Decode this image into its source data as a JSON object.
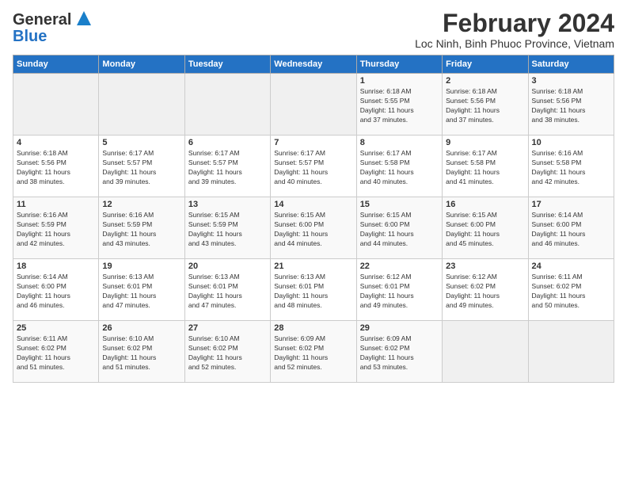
{
  "logo": {
    "line1": "General",
    "line2": "Blue"
  },
  "title": "February 2024",
  "location": "Loc Ninh, Binh Phuoc Province, Vietnam",
  "days_of_week": [
    "Sunday",
    "Monday",
    "Tuesday",
    "Wednesday",
    "Thursday",
    "Friday",
    "Saturday"
  ],
  "weeks": [
    [
      {
        "day": "",
        "info": ""
      },
      {
        "day": "",
        "info": ""
      },
      {
        "day": "",
        "info": ""
      },
      {
        "day": "",
        "info": ""
      },
      {
        "day": "1",
        "info": "Sunrise: 6:18 AM\nSunset: 5:55 PM\nDaylight: 11 hours\nand 37 minutes."
      },
      {
        "day": "2",
        "info": "Sunrise: 6:18 AM\nSunset: 5:56 PM\nDaylight: 11 hours\nand 37 minutes."
      },
      {
        "day": "3",
        "info": "Sunrise: 6:18 AM\nSunset: 5:56 PM\nDaylight: 11 hours\nand 38 minutes."
      }
    ],
    [
      {
        "day": "4",
        "info": "Sunrise: 6:18 AM\nSunset: 5:56 PM\nDaylight: 11 hours\nand 38 minutes."
      },
      {
        "day": "5",
        "info": "Sunrise: 6:17 AM\nSunset: 5:57 PM\nDaylight: 11 hours\nand 39 minutes."
      },
      {
        "day": "6",
        "info": "Sunrise: 6:17 AM\nSunset: 5:57 PM\nDaylight: 11 hours\nand 39 minutes."
      },
      {
        "day": "7",
        "info": "Sunrise: 6:17 AM\nSunset: 5:57 PM\nDaylight: 11 hours\nand 40 minutes."
      },
      {
        "day": "8",
        "info": "Sunrise: 6:17 AM\nSunset: 5:58 PM\nDaylight: 11 hours\nand 40 minutes."
      },
      {
        "day": "9",
        "info": "Sunrise: 6:17 AM\nSunset: 5:58 PM\nDaylight: 11 hours\nand 41 minutes."
      },
      {
        "day": "10",
        "info": "Sunrise: 6:16 AM\nSunset: 5:58 PM\nDaylight: 11 hours\nand 42 minutes."
      }
    ],
    [
      {
        "day": "11",
        "info": "Sunrise: 6:16 AM\nSunset: 5:59 PM\nDaylight: 11 hours\nand 42 minutes."
      },
      {
        "day": "12",
        "info": "Sunrise: 6:16 AM\nSunset: 5:59 PM\nDaylight: 11 hours\nand 43 minutes."
      },
      {
        "day": "13",
        "info": "Sunrise: 6:15 AM\nSunset: 5:59 PM\nDaylight: 11 hours\nand 43 minutes."
      },
      {
        "day": "14",
        "info": "Sunrise: 6:15 AM\nSunset: 6:00 PM\nDaylight: 11 hours\nand 44 minutes."
      },
      {
        "day": "15",
        "info": "Sunrise: 6:15 AM\nSunset: 6:00 PM\nDaylight: 11 hours\nand 44 minutes."
      },
      {
        "day": "16",
        "info": "Sunrise: 6:15 AM\nSunset: 6:00 PM\nDaylight: 11 hours\nand 45 minutes."
      },
      {
        "day": "17",
        "info": "Sunrise: 6:14 AM\nSunset: 6:00 PM\nDaylight: 11 hours\nand 46 minutes."
      }
    ],
    [
      {
        "day": "18",
        "info": "Sunrise: 6:14 AM\nSunset: 6:00 PM\nDaylight: 11 hours\nand 46 minutes."
      },
      {
        "day": "19",
        "info": "Sunrise: 6:13 AM\nSunset: 6:01 PM\nDaylight: 11 hours\nand 47 minutes."
      },
      {
        "day": "20",
        "info": "Sunrise: 6:13 AM\nSunset: 6:01 PM\nDaylight: 11 hours\nand 47 minutes."
      },
      {
        "day": "21",
        "info": "Sunrise: 6:13 AM\nSunset: 6:01 PM\nDaylight: 11 hours\nand 48 minutes."
      },
      {
        "day": "22",
        "info": "Sunrise: 6:12 AM\nSunset: 6:01 PM\nDaylight: 11 hours\nand 49 minutes."
      },
      {
        "day": "23",
        "info": "Sunrise: 6:12 AM\nSunset: 6:02 PM\nDaylight: 11 hours\nand 49 minutes."
      },
      {
        "day": "24",
        "info": "Sunrise: 6:11 AM\nSunset: 6:02 PM\nDaylight: 11 hours\nand 50 minutes."
      }
    ],
    [
      {
        "day": "25",
        "info": "Sunrise: 6:11 AM\nSunset: 6:02 PM\nDaylight: 11 hours\nand 51 minutes."
      },
      {
        "day": "26",
        "info": "Sunrise: 6:10 AM\nSunset: 6:02 PM\nDaylight: 11 hours\nand 51 minutes."
      },
      {
        "day": "27",
        "info": "Sunrise: 6:10 AM\nSunset: 6:02 PM\nDaylight: 11 hours\nand 52 minutes."
      },
      {
        "day": "28",
        "info": "Sunrise: 6:09 AM\nSunset: 6:02 PM\nDaylight: 11 hours\nand 52 minutes."
      },
      {
        "day": "29",
        "info": "Sunrise: 6:09 AM\nSunset: 6:02 PM\nDaylight: 11 hours\nand 53 minutes."
      },
      {
        "day": "",
        "info": ""
      },
      {
        "day": "",
        "info": ""
      }
    ]
  ]
}
